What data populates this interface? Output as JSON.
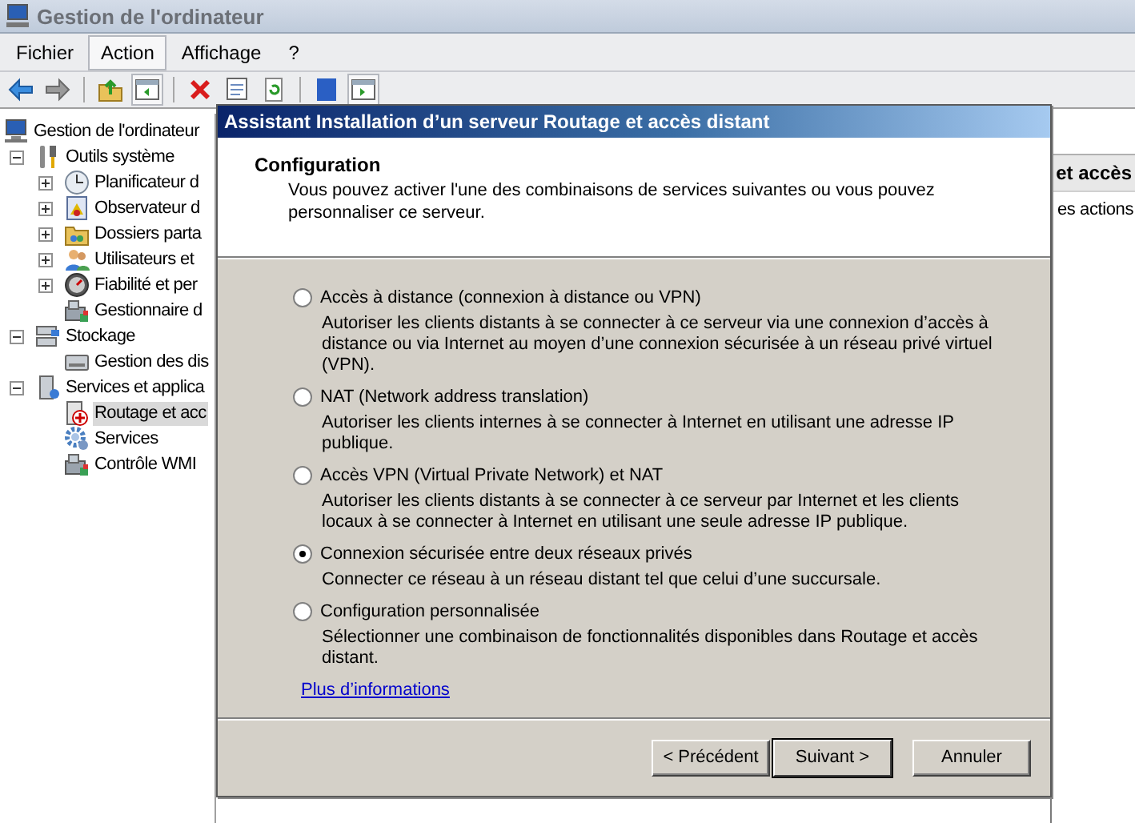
{
  "window": {
    "title": "Gestion de l'ordinateur"
  },
  "menu": [
    {
      "label": "Fichier",
      "selected": false
    },
    {
      "label": "Action",
      "selected": true
    },
    {
      "label": "Affichage",
      "selected": false
    },
    {
      "label": "?",
      "selected": false
    }
  ],
  "tree": [
    {
      "label": "Gestion de l'ordinateur",
      "kind": "computer",
      "selected": false,
      "children": [
        {
          "label": "Outils système",
          "kind": "tools",
          "expanded": true,
          "selected": false,
          "children": [
            {
              "label": "Planificateur d",
              "kind": "clock",
              "expanded": false,
              "selected": false
            },
            {
              "label": "Observateur d",
              "kind": "eventlog",
              "expanded": false,
              "selected": false
            },
            {
              "label": "Dossiers parta",
              "kind": "share",
              "expanded": false,
              "selected": false
            },
            {
              "label": "Utilisateurs et",
              "kind": "users",
              "expanded": false,
              "selected": false
            },
            {
              "label": "Fiabilité et per",
              "kind": "gauge",
              "expanded": false,
              "selected": false
            },
            {
              "label": "Gestionnaire d",
              "kind": "device",
              "selected": false
            }
          ]
        },
        {
          "label": "Stockage",
          "kind": "storage",
          "expanded": true,
          "selected": false,
          "children": [
            {
              "label": "Gestion des dis",
              "kind": "disk",
              "selected": false
            }
          ]
        },
        {
          "label": "Services et applica",
          "kind": "services",
          "expanded": true,
          "selected": false,
          "children": [
            {
              "label": "Routage et acc",
              "kind": "routing",
              "selected": true
            },
            {
              "label": "Services",
              "kind": "gear",
              "selected": false
            },
            {
              "label": "Contrôle WMI",
              "kind": "device",
              "selected": false
            }
          ]
        }
      ]
    }
  ],
  "actions_pane": {
    "header": "et accès",
    "items": [
      "es actions"
    ]
  },
  "dialog": {
    "title": "Assistant Installation d’un serveur Routage et accès distant",
    "heading": "Configuration",
    "description": "Vous pouvez activer l'une des combinaisons de services suivantes ou vous pouvez personnaliser ce serveur.",
    "options": [
      {
        "label": "Accès à distance (connexion à distance ou VPN)",
        "description": "Autoriser les clients distants à se connecter à ce serveur via une connexion d’accès à distance ou via Internet au moyen d’une connexion sécurisée à un réseau privé virtuel (VPN).",
        "selected": false
      },
      {
        "label": "NAT (Network address translation)",
        "description": "Autoriser les clients internes à se connecter à Internet en utilisant une adresse IP publique.",
        "selected": false
      },
      {
        "label": "Accès VPN (Virtual Private Network) et NAT",
        "description": "Autoriser les clients distants à se connecter à ce serveur par Internet et les clients locaux à se connecter à Internet en utilisant une seule adresse IP publique.",
        "selected": false
      },
      {
        "label": "Connexion sécurisée entre deux réseaux privés",
        "description": "Connecter ce réseau à un réseau distant tel que celui d’une succursale.",
        "selected": true
      },
      {
        "label": "Configuration personnalisée",
        "description": "Sélectionner une combinaison de fonctionnalités disponibles dans Routage et accès distant.",
        "selected": false
      }
    ],
    "link": "Plus d’informations",
    "buttons": [
      {
        "label": "< Précédent",
        "default": false
      },
      {
        "label": "Suivant >",
        "default": true
      },
      {
        "label": "Annuler",
        "default": false
      }
    ]
  }
}
